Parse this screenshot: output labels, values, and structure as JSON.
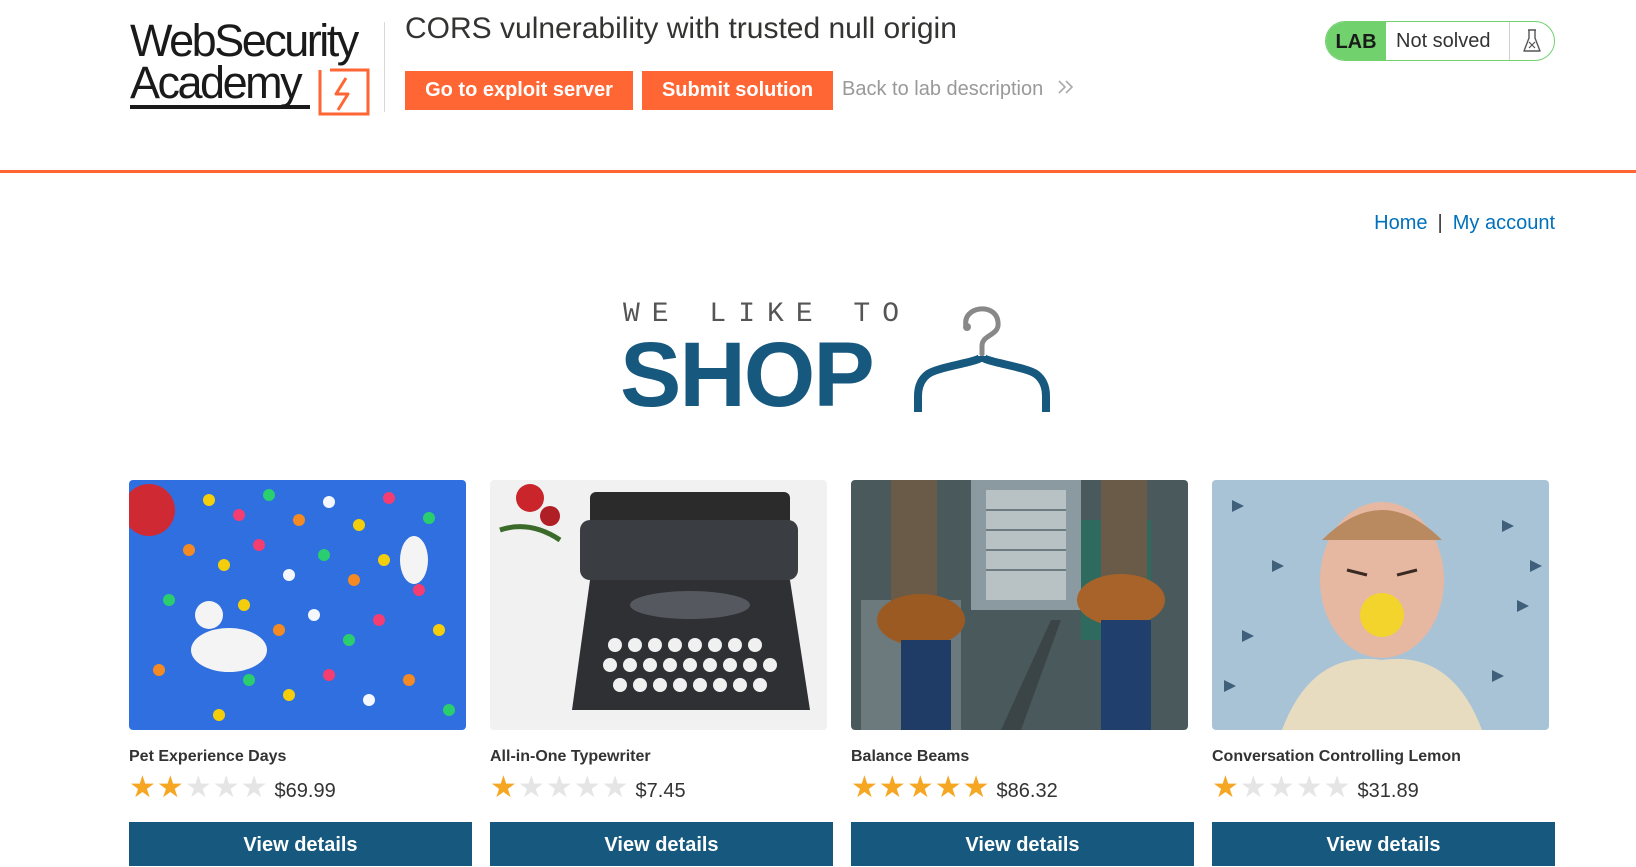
{
  "header": {
    "logo_line1": "WebSecurity",
    "logo_line2": "Academy",
    "lab_title": "CORS vulnerability with trusted null origin",
    "exploit_button": "Go to exploit server",
    "submit_button": "Submit solution",
    "back_link": "Back to lab description",
    "back_link_icon": "double-chevron-right-icon",
    "lab_badge": "LAB",
    "lab_status": "Not solved",
    "status_icon": "flask-icon"
  },
  "nav": {
    "home": "Home",
    "separator": "|",
    "account": "My account"
  },
  "banner": {
    "small": "WE LIKE TO",
    "big": "SHOP",
    "icon": "hanger-icon"
  },
  "colors": {
    "accent_orange": "#ff6633",
    "shop_blue": "#17597e",
    "link_blue": "#0071bc",
    "lab_green": "#70d16d",
    "star_gold": "#f5a623"
  },
  "products": [
    {
      "name": "Pet Experience Days",
      "rating": 2,
      "max_rating": 5,
      "price": "$69.99",
      "button": "View details"
    },
    {
      "name": "All-in-One Typewriter",
      "rating": 1,
      "max_rating": 5,
      "price": "$7.45",
      "button": "View details"
    },
    {
      "name": "Balance Beams",
      "rating": 5,
      "max_rating": 5,
      "price": "$86.32",
      "button": "View details"
    },
    {
      "name": "Conversation Controlling Lemon",
      "rating": 1,
      "max_rating": 5,
      "price": "$31.89",
      "button": "View details"
    }
  ]
}
